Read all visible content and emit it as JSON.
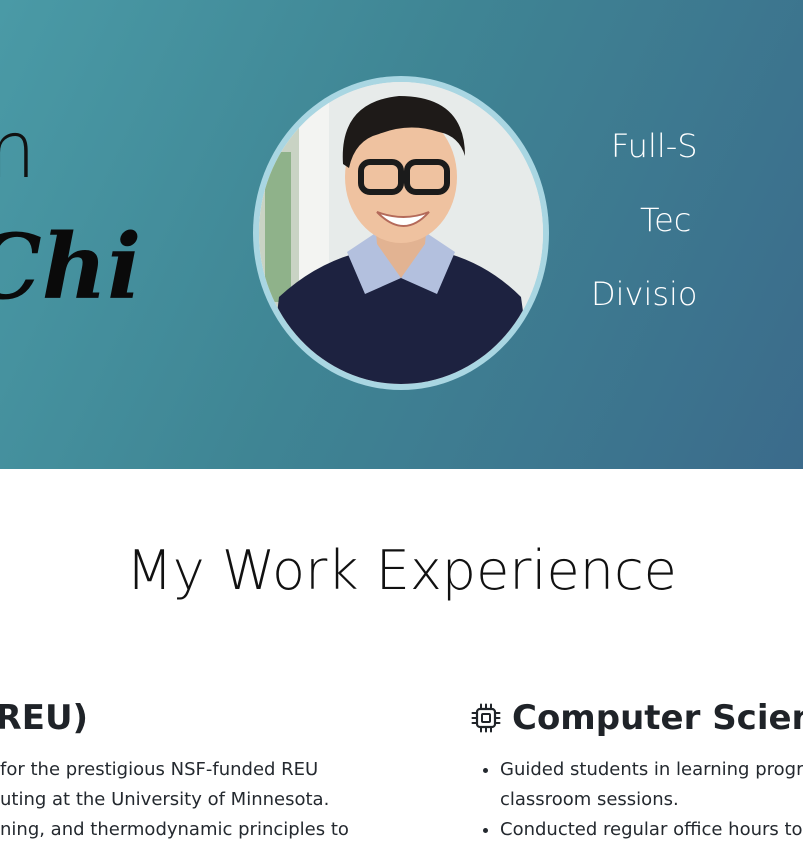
{
  "hero": {
    "greeting": "m",
    "surname": "Chi",
    "roles": [
      "Full-S",
      "Tec",
      "Divisio"
    ],
    "avatar_alt": "profile-photo"
  },
  "experience": {
    "title": "My Work Experience",
    "jobs": [
      {
        "title": "(REU)",
        "icon": "",
        "bullets": [
          "for the prestigious NSF-funded REU",
          "uting at the University of Minnesota.",
          "ning, and thermodynamic principles to"
        ]
      },
      {
        "title": "Computer Scienc",
        "icon": "chip-icon",
        "bullets": [
          "Guided students in learning progra",
          "classroom sessions.",
          "Conducted regular office hours to"
        ]
      }
    ]
  }
}
